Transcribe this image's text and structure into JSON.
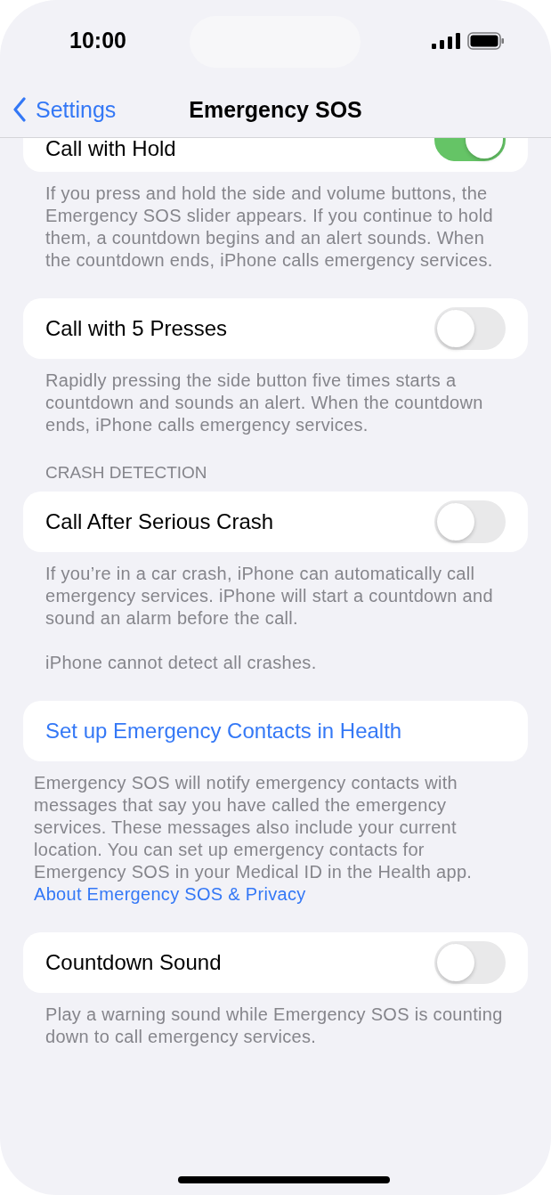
{
  "status_bar": {
    "time": "10:00"
  },
  "nav": {
    "back": "Settings",
    "title": "Emergency SOS"
  },
  "sections": [
    {
      "rows": [
        {
          "kind": "toggle",
          "label": "Call with Hold",
          "on": true
        }
      ],
      "footer": [
        {
          "kind": "text",
          "text": "If you press and hold the side and volume buttons, the Emergency SOS slider appears. If you continue to hold them, a countdown begins and an alert sounds. When the countdown ends, iPhone calls emergency services."
        }
      ]
    },
    {
      "rows": [
        {
          "kind": "toggle",
          "label": "Call with 5 Presses",
          "on": false
        }
      ],
      "footer": [
        {
          "kind": "text",
          "text": "Rapidly pressing the side button five times starts a countdown and sounds an alert. When the countdown ends, iPhone calls emergency services."
        }
      ]
    },
    {
      "header": "CRASH DETECTION",
      "rows": [
        {
          "kind": "toggle",
          "label": "Call After Serious Crash",
          "on": false
        }
      ],
      "footer": [
        {
          "kind": "text",
          "text": "If you’re in a car crash, iPhone can automatically call emergency services. iPhone will start a countdown and sound an alarm before the call."
        },
        {
          "kind": "text",
          "text": "iPhone cannot detect all crashes."
        }
      ]
    },
    {
      "rows": [
        {
          "kind": "link",
          "label": "Set up Emergency Contacts in Health"
        }
      ],
      "footer": [
        {
          "kind": "text",
          "text": "Emergency SOS will notify emergency contacts with messages that say you have called the emergency services. These messages also include your current location. You can set up emergency contacts for Emergency SOS in your Medical ID in the Health app."
        },
        {
          "kind": "link",
          "text": "About Emergency SOS & Privacy"
        }
      ]
    },
    {
      "rows": [
        {
          "kind": "toggle",
          "label": "Countdown Sound",
          "on": false
        }
      ],
      "footer": [
        {
          "kind": "text",
          "text": "Play a warning sound while Emergency SOS is counting down to call emergency services."
        }
      ]
    }
  ]
}
